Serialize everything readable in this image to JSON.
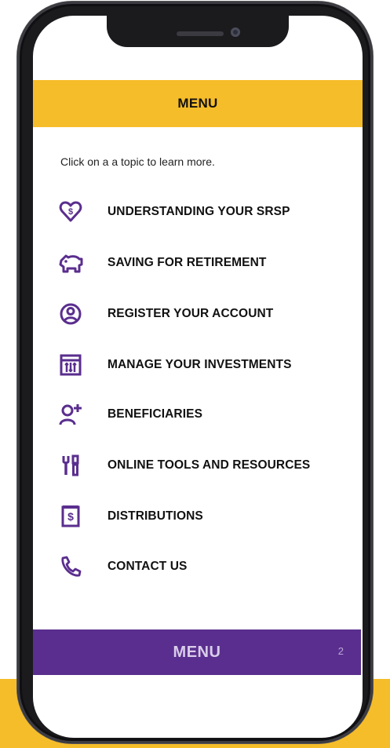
{
  "header": {
    "title": "MENU"
  },
  "intro": "Click on a a topic to learn more.",
  "menu": {
    "items": [
      {
        "label": "UNDERSTANDING YOUR SRSP",
        "icon": "heart-dollar-icon"
      },
      {
        "label": "SAVING FOR RETIREMENT",
        "icon": "piggy-bank-icon"
      },
      {
        "label": "REGISTER YOUR ACCOUNT",
        "icon": "user-circle-icon"
      },
      {
        "label": "MANAGE YOUR INVESTMENTS",
        "icon": "sliders-panel-icon"
      },
      {
        "label": "BENEFICIARIES",
        "icon": "user-add-icon"
      },
      {
        "label": "ONLINE TOOLS AND RESOURCES",
        "icon": "tools-icon"
      },
      {
        "label": "DISTRIBUTIONS",
        "icon": "dollar-document-icon"
      },
      {
        "label": "CONTACT US",
        "icon": "phone-icon"
      }
    ]
  },
  "footer": {
    "title": "MENU",
    "page_number": "2"
  },
  "colors": {
    "accent_yellow": "#f6bd2a",
    "brand_purple": "#5a2e8e",
    "icon_purple": "#5a2e8e"
  }
}
